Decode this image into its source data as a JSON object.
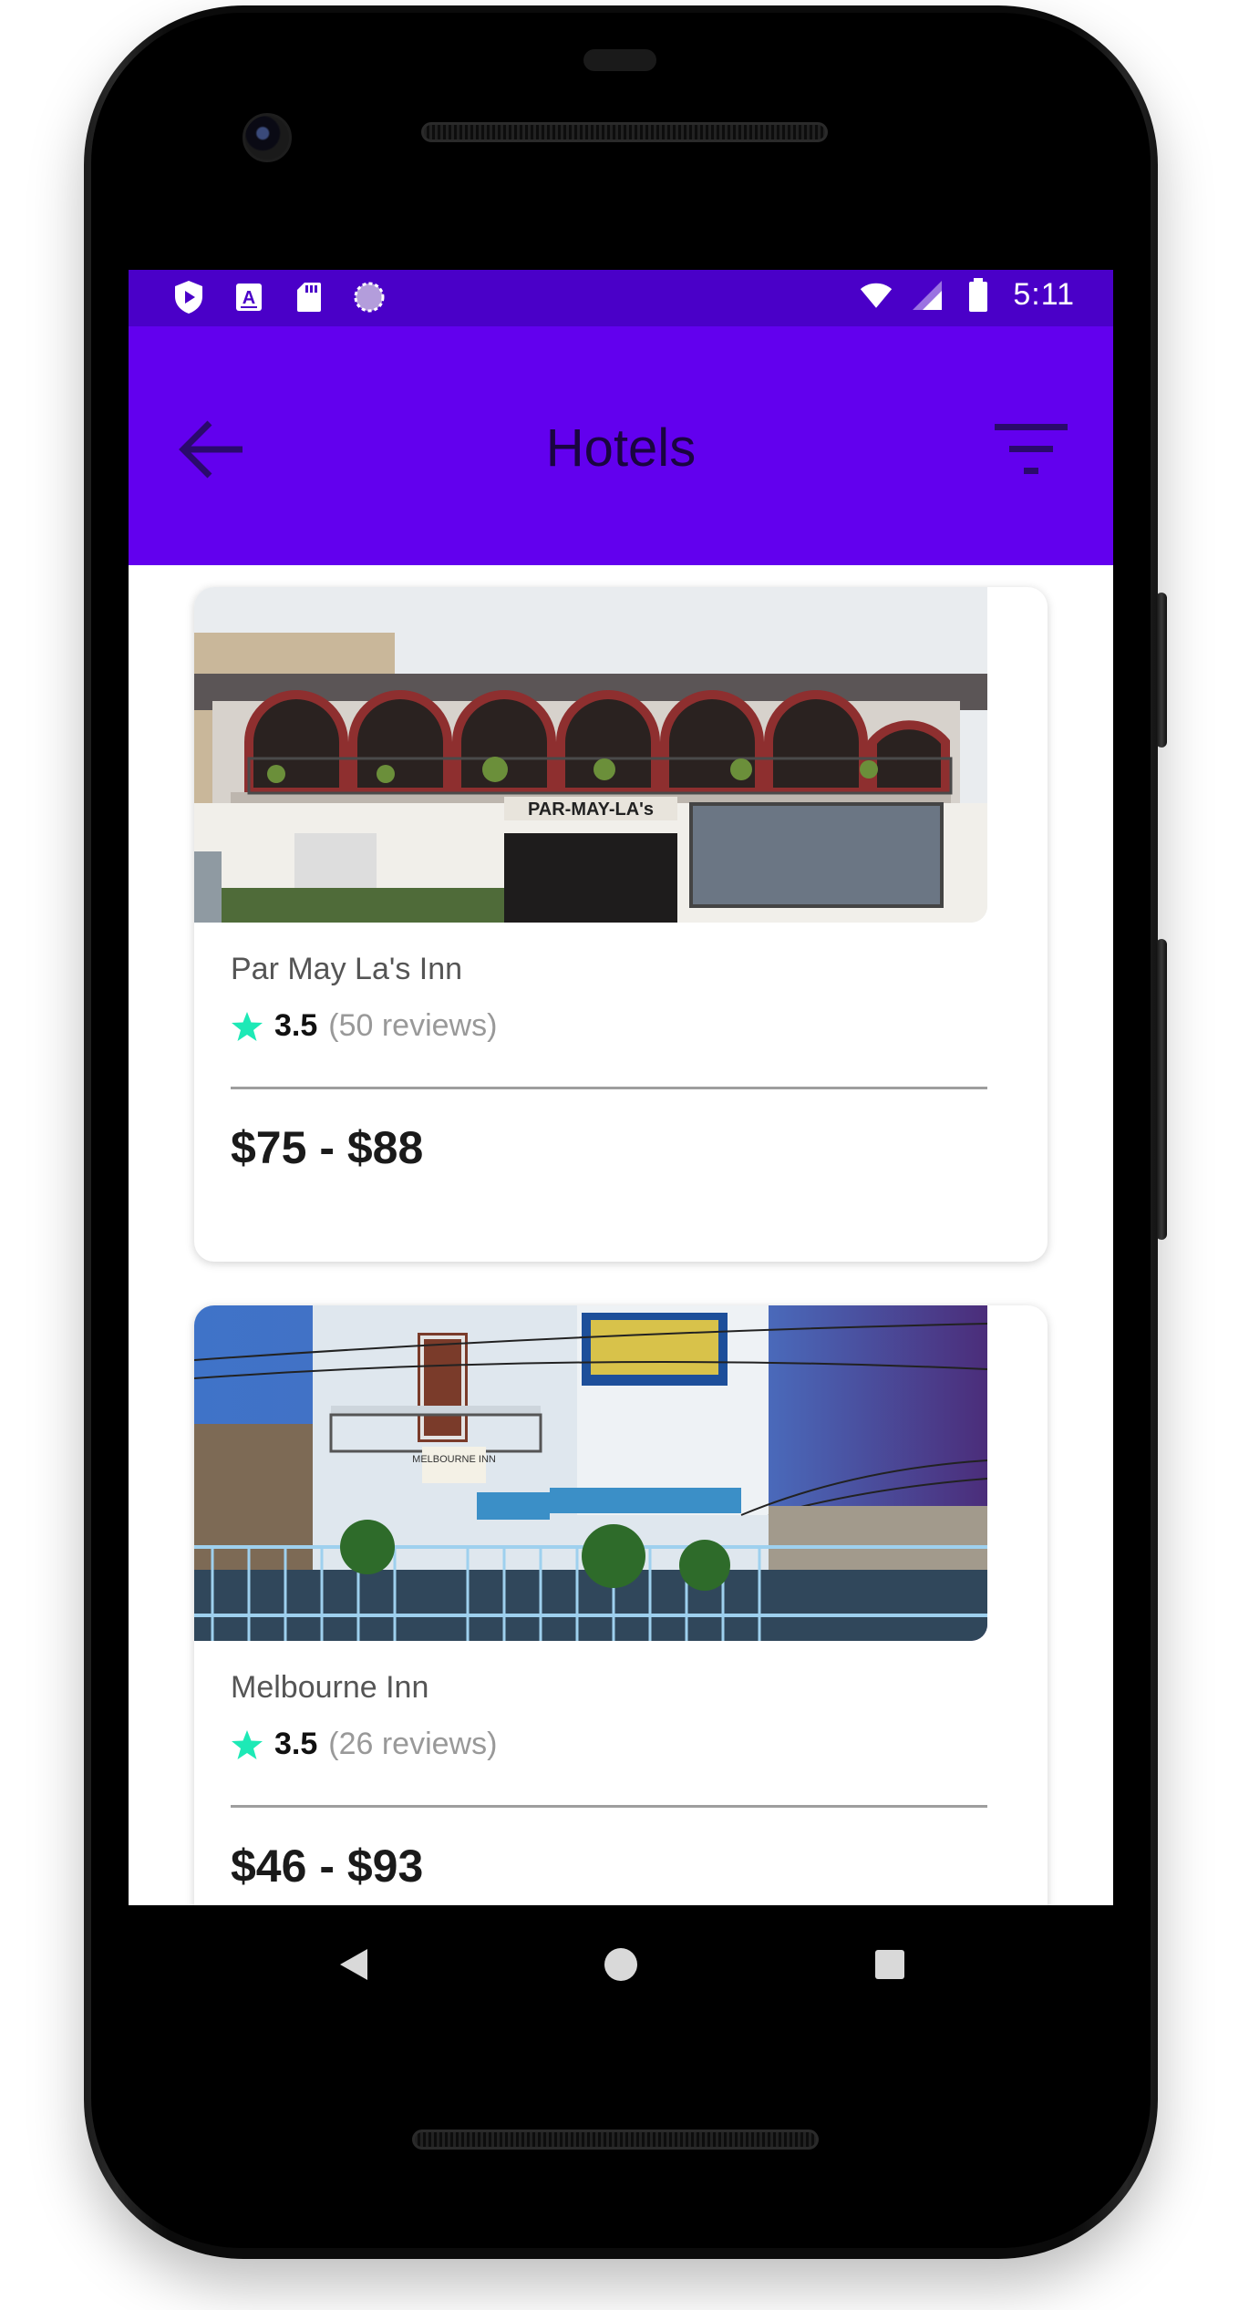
{
  "status_bar": {
    "time": "5:11",
    "left_icons": [
      "shield-play-icon",
      "text-a-icon",
      "sd-card-icon",
      "sync-circle-icon"
    ],
    "right_icons": [
      "wifi-icon",
      "cell-signal-icon",
      "battery-icon"
    ]
  },
  "app_bar": {
    "title": "Hotels",
    "back_icon": "arrow-back-icon",
    "filter_icon": "filter-icon",
    "background": "#6200ee",
    "status_background": "#4a00c8"
  },
  "hotels": [
    {
      "name": "Par May La's Inn",
      "rating": "3.5",
      "reviews": "(50 reviews)",
      "price": "$75 - $88",
      "photo_sign": "PAR-MAY-LA's"
    },
    {
      "name": "Melbourne Inn",
      "rating": "3.5",
      "reviews": "(26 reviews)",
      "price": "$46 - $93",
      "photo_sign": "MELBOURNE INN"
    }
  ],
  "accent": {
    "star": "#1de9b6"
  },
  "nav": {
    "icons": [
      "back-triangle-icon",
      "home-circle-icon",
      "recents-square-icon"
    ]
  }
}
